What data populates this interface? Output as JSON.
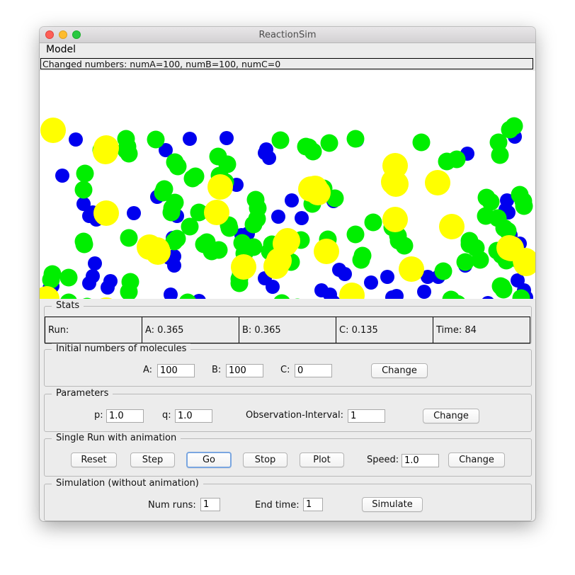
{
  "window": {
    "title": "ReactionSim"
  },
  "menu": {
    "model": "Model"
  },
  "status": {
    "text": "Changed numbers: numA=100, numB=100, numC=0"
  },
  "colors": {
    "molecule_a": "#0000ee",
    "molecule_b": "#00ee00",
    "molecule_c": "#ffff00"
  },
  "stats": {
    "legend": "Stats",
    "run": "Run:",
    "a": "A: 0.365",
    "b": "B: 0.365",
    "c": "C: 0.135",
    "time": "Time: 84"
  },
  "initial": {
    "legend": "Initial numbers of molecules",
    "a_label": "A:",
    "a_value": "100",
    "b_label": "B:",
    "b_value": "100",
    "c_label": "C:",
    "c_value": "0",
    "change": "Change"
  },
  "params": {
    "legend": "Parameters",
    "p_label": "p:",
    "p_value": "1.0",
    "q_label": "q:",
    "q_value": "1.0",
    "obs_label": "Observation-Interval:",
    "obs_value": "1",
    "change": "Change"
  },
  "single": {
    "legend": "Single Run with animation",
    "reset": "Reset",
    "step": "Step",
    "go": "Go",
    "stop": "Stop",
    "plot": "Plot",
    "speed_label": "Speed:",
    "speed_value": "1.0",
    "change": "Change"
  },
  "sim": {
    "legend": "Simulation (without animation)",
    "runs_label": "Num runs:",
    "runs_value": "1",
    "end_label": "End time:",
    "end_value": "1",
    "simulate": "Simulate"
  }
}
